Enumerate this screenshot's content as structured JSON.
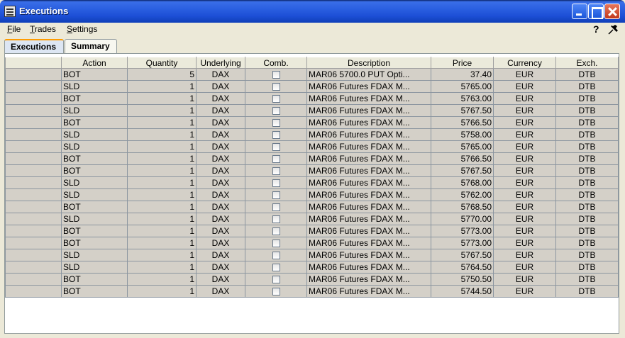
{
  "window": {
    "title": "Executions"
  },
  "menu": [
    {
      "label": "File",
      "mnemonic": "F",
      "rest": "ile"
    },
    {
      "label": "Trades",
      "mnemonic": "T",
      "rest": "rades"
    },
    {
      "label": "Settings",
      "mnemonic": "S",
      "rest": "ettings"
    }
  ],
  "help_label": "?",
  "tabs": [
    {
      "label": "Executions",
      "active": true
    },
    {
      "label": "Summary",
      "active": false
    }
  ],
  "table": {
    "columns": [
      "",
      "Action",
      "Quantity",
      "Underlying",
      "Comb.",
      "Description",
      "Price",
      "Currency",
      "Exch."
    ],
    "rows": [
      {
        "action": "BOT",
        "quantity": "5",
        "underlying": "DAX",
        "description": "MAR06 5700.0 PUT Opti...",
        "price": "37.40",
        "currency": "EUR",
        "exch": "DTB"
      },
      {
        "action": "SLD",
        "quantity": "1",
        "underlying": "DAX",
        "description": "MAR06 Futures FDAX M...",
        "price": "5765.00",
        "currency": "EUR",
        "exch": "DTB"
      },
      {
        "action": "BOT",
        "quantity": "1",
        "underlying": "DAX",
        "description": "MAR06 Futures FDAX M...",
        "price": "5763.00",
        "currency": "EUR",
        "exch": "DTB"
      },
      {
        "action": "SLD",
        "quantity": "1",
        "underlying": "DAX",
        "description": "MAR06 Futures FDAX M...",
        "price": "5767.50",
        "currency": "EUR",
        "exch": "DTB"
      },
      {
        "action": "BOT",
        "quantity": "1",
        "underlying": "DAX",
        "description": "MAR06 Futures FDAX M...",
        "price": "5766.50",
        "currency": "EUR",
        "exch": "DTB"
      },
      {
        "action": "SLD",
        "quantity": "1",
        "underlying": "DAX",
        "description": "MAR06 Futures FDAX M...",
        "price": "5758.00",
        "currency": "EUR",
        "exch": "DTB"
      },
      {
        "action": "SLD",
        "quantity": "1",
        "underlying": "DAX",
        "description": "MAR06 Futures FDAX M...",
        "price": "5765.00",
        "currency": "EUR",
        "exch": "DTB"
      },
      {
        "action": "BOT",
        "quantity": "1",
        "underlying": "DAX",
        "description": "MAR06 Futures FDAX M...",
        "price": "5766.50",
        "currency": "EUR",
        "exch": "DTB"
      },
      {
        "action": "BOT",
        "quantity": "1",
        "underlying": "DAX",
        "description": "MAR06 Futures FDAX M...",
        "price": "5767.50",
        "currency": "EUR",
        "exch": "DTB"
      },
      {
        "action": "SLD",
        "quantity": "1",
        "underlying": "DAX",
        "description": "MAR06 Futures FDAX M...",
        "price": "5768.00",
        "currency": "EUR",
        "exch": "DTB"
      },
      {
        "action": "SLD",
        "quantity": "1",
        "underlying": "DAX",
        "description": "MAR06 Futures FDAX M...",
        "price": "5762.00",
        "currency": "EUR",
        "exch": "DTB"
      },
      {
        "action": "BOT",
        "quantity": "1",
        "underlying": "DAX",
        "description": "MAR06 Futures FDAX M...",
        "price": "5768.50",
        "currency": "EUR",
        "exch": "DTB"
      },
      {
        "action": "SLD",
        "quantity": "1",
        "underlying": "DAX",
        "description": "MAR06 Futures FDAX M...",
        "price": "5770.00",
        "currency": "EUR",
        "exch": "DTB"
      },
      {
        "action": "BOT",
        "quantity": "1",
        "underlying": "DAX",
        "description": "MAR06 Futures FDAX M...",
        "price": "5773.00",
        "currency": "EUR",
        "exch": "DTB"
      },
      {
        "action": "BOT",
        "quantity": "1",
        "underlying": "DAX",
        "description": "MAR06 Futures FDAX M...",
        "price": "5773.00",
        "currency": "EUR",
        "exch": "DTB"
      },
      {
        "action": "SLD",
        "quantity": "1",
        "underlying": "DAX",
        "description": "MAR06 Futures FDAX M...",
        "price": "5767.50",
        "currency": "EUR",
        "exch": "DTB"
      },
      {
        "action": "SLD",
        "quantity": "1",
        "underlying": "DAX",
        "description": "MAR06 Futures FDAX M...",
        "price": "5764.50",
        "currency": "EUR",
        "exch": "DTB"
      },
      {
        "action": "BOT",
        "quantity": "1",
        "underlying": "DAX",
        "description": "MAR06 Futures FDAX M...",
        "price": "5750.50",
        "currency": "EUR",
        "exch": "DTB"
      },
      {
        "action": "BOT",
        "quantity": "1",
        "underlying": "DAX",
        "description": "MAR06 Futures FDAX M...",
        "price": "5744.50",
        "currency": "EUR",
        "exch": "DTB"
      }
    ]
  }
}
